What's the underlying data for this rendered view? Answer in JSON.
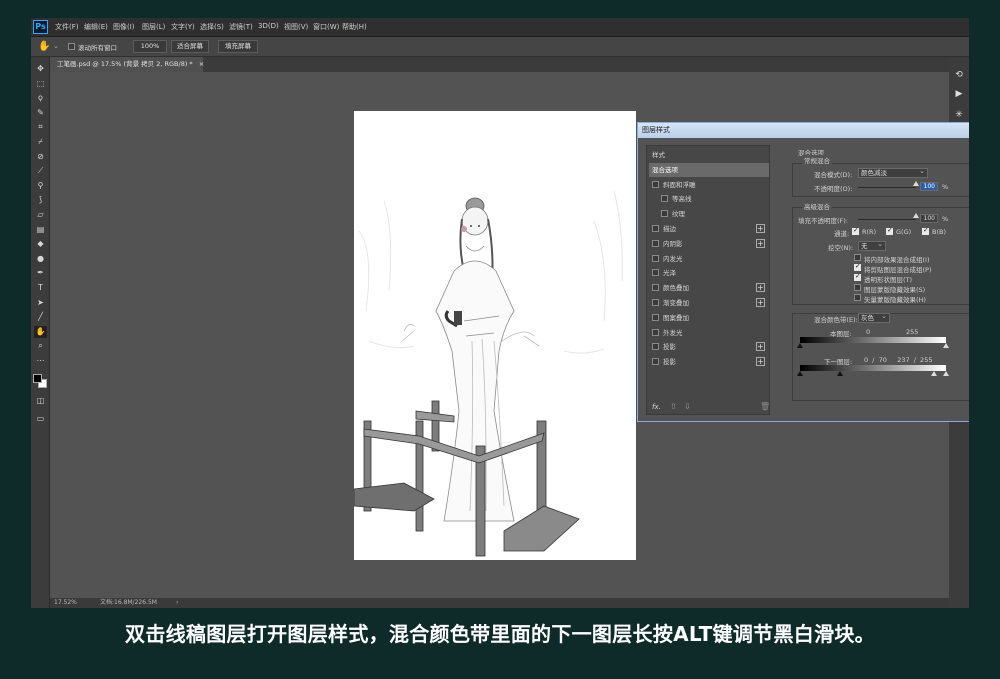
{
  "app": {
    "logo": "Ps"
  },
  "menu": [
    "文件(F)",
    "编辑(E)",
    "图像(I)",
    "图层(L)",
    "文字(Y)",
    "选择(S)",
    "滤镜(T)",
    "3D(D)",
    "视图(V)",
    "窗口(W)",
    "帮助(H)"
  ],
  "options": {
    "scroll_all": "滚动所有窗口",
    "zoom": "100%",
    "fit_screen": "适合屏幕",
    "fill_screen": "填充屏幕"
  },
  "document_tab": "工笔画.psd @ 17.5% (背景 拷贝 2, RGB/8) *",
  "status": {
    "zoom": "17.52%",
    "doc": "文档:16.8M/226.5M"
  },
  "dialog": {
    "title": "图层样式",
    "styles": [
      {
        "label": "样式",
        "check": false,
        "plus": false,
        "sel": false,
        "indent": 0,
        "hasbox": false
      },
      {
        "label": "混合选项",
        "check": false,
        "plus": false,
        "sel": true,
        "indent": 0,
        "hasbox": false
      },
      {
        "label": "斜面和浮雕",
        "check": false,
        "plus": false,
        "sel": false,
        "indent": 0,
        "hasbox": true
      },
      {
        "label": "等高线",
        "check": false,
        "plus": false,
        "sel": false,
        "indent": 1,
        "hasbox": true
      },
      {
        "label": "纹理",
        "check": false,
        "plus": false,
        "sel": false,
        "indent": 1,
        "hasbox": true
      },
      {
        "label": "描边",
        "check": false,
        "plus": true,
        "sel": false,
        "indent": 0,
        "hasbox": true
      },
      {
        "label": "内阴影",
        "check": false,
        "plus": true,
        "sel": false,
        "indent": 0,
        "hasbox": true
      },
      {
        "label": "内发光",
        "check": false,
        "plus": false,
        "sel": false,
        "indent": 0,
        "hasbox": true
      },
      {
        "label": "光泽",
        "check": false,
        "plus": false,
        "sel": false,
        "indent": 0,
        "hasbox": true
      },
      {
        "label": "颜色叠加",
        "check": false,
        "plus": true,
        "sel": false,
        "indent": 0,
        "hasbox": true
      },
      {
        "label": "渐变叠加",
        "check": false,
        "plus": true,
        "sel": false,
        "indent": 0,
        "hasbox": true
      },
      {
        "label": "图案叠加",
        "check": false,
        "plus": false,
        "sel": false,
        "indent": 0,
        "hasbox": true
      },
      {
        "label": "外发光",
        "check": false,
        "plus": false,
        "sel": false,
        "indent": 0,
        "hasbox": true
      },
      {
        "label": "投影",
        "check": false,
        "plus": true,
        "sel": false,
        "indent": 0,
        "hasbox": true
      },
      {
        "label": "投影",
        "check": false,
        "plus": true,
        "sel": false,
        "indent": 0,
        "hasbox": true
      }
    ],
    "fx": "fx.",
    "blend": {
      "section": "混合选项",
      "general": "常规混合",
      "mode_label": "混合模式(D):",
      "mode_value": "颜色减淡",
      "opacity_label": "不透明度(O):",
      "opacity_value": "100",
      "pct": "%",
      "advanced": "高级混合",
      "fill_label": "填充不透明度(F):",
      "fill_value": "100",
      "channels_label": "通道:",
      "ch_r": "R(R)",
      "ch_g": "G(G)",
      "ch_b": "B(B)",
      "knockout_label": "挖空(N):",
      "knockout_value": "无",
      "opt1": "将内部效果混合成组(I)",
      "opt2": "将剪贴图层混合成组(P)",
      "opt3": "透明形状图层(T)",
      "opt4": "图层蒙版隐藏效果(S)",
      "opt5": "矢量蒙版隐藏效果(H)",
      "blendif_label": "混合颜色带(E):",
      "blendif_value": "灰色",
      "this_layer": "本图层:",
      "this_min": "0",
      "this_max": "255",
      "under_layer": "下一图层:",
      "under_values": "0  /  70     237  /  255"
    }
  },
  "caption": "双击线稿图层打开图层样式，混合颜色带里面的下一图层长按ALT键调节黑白滑块。"
}
